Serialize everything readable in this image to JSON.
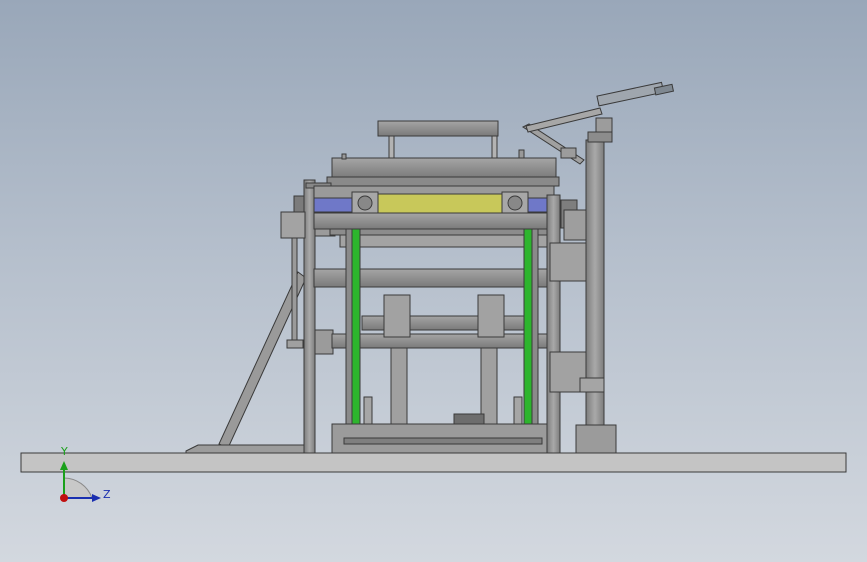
{
  "viewport": {
    "background_top": "#99a7b9",
    "background_bottom": "#d3d8df"
  },
  "model": {
    "part_color": "#8f8f8f",
    "outline_color": "#3a3a3a",
    "guide_rail_color": "#2db52d",
    "upper_platen_color": "#c8c85a",
    "blue_beam_color": "#6f78c8"
  },
  "triad": {
    "y_label": "Y",
    "z_label": "Z",
    "y_color": "#1aa01a",
    "z_color": "#1a2fb0",
    "origin_color": "#c01010"
  }
}
